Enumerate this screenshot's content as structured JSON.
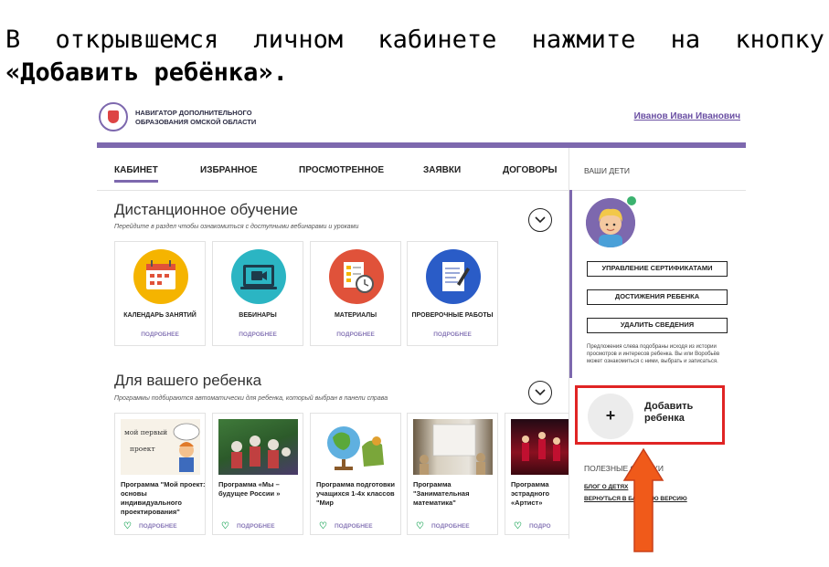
{
  "instruction": {
    "line1_words": [
      "В",
      "открывшемся",
      "личном",
      "кабинете",
      "нажмите",
      "на",
      "кнопку"
    ],
    "line2": "«Добавить ребёнка»."
  },
  "header": {
    "brand_line1": "НАВИГАТОР ДОПОЛНИТЕЛЬНОГО",
    "brand_line2": "ОБРАЗОВАНИЯ ОМСКОЙ ОБЛАСТИ",
    "user_name": "Иванов Иван Иванович"
  },
  "tabs": [
    "КАБИНЕТ",
    "ИЗБРАННОЕ",
    "ПРОСМОТРЕННОЕ",
    "ЗАЯВКИ",
    "ДОГОВОРЫ"
  ],
  "distance": {
    "title": "Дистанционное обучение",
    "subtitle": "Перейдите в раздел чтобы ознакомиться с доступными вебинарами и уроками",
    "more": "ПОДРОБНЕЕ",
    "cards": [
      {
        "name": "КАЛЕНДАРЬ ЗАНЯТИЙ",
        "icon": "calendar-icon"
      },
      {
        "name": "ВЕБИНАРЫ",
        "icon": "webcam-icon"
      },
      {
        "name": "МАТЕРИАЛЫ",
        "icon": "materials-clock-icon"
      },
      {
        "name": "ПРОВЕРОЧНЫЕ РАБОТЫ",
        "icon": "document-pencil-icon"
      }
    ]
  },
  "child": {
    "title": "Для вашего ребенка",
    "subtitle": "Программы подбираются автоматически для ребенка, который выбран в панели справа",
    "more": "ПОДРОБНЕЕ",
    "more_cut": "ПОДРО",
    "programs": [
      {
        "title": "Программа \"Мой проект: основы индивидуального проектирования\"",
        "img_text1": "мой первый",
        "img_text2": "проект"
      },
      {
        "title": "Программа «Мы – будущее России »"
      },
      {
        "title": "Программа подготовки учащихся 1-4х классов \"Мир"
      },
      {
        "title": "Программа \"Занимательная математика\""
      },
      {
        "title": "Программа эстрадного «Артист»"
      }
    ]
  },
  "right": {
    "header": "ВАШИ ДЕТИ",
    "buttons": [
      "УПРАВЛЕНИЕ СЕРТИФИКАТАМИ",
      "ДОСТИЖЕНИЯ РЕБЕНКА",
      "УДАЛИТЬ СВЕДЕНИЯ"
    ],
    "note": "Предложения слева подобраны исходя из истории просмотров и интересов ребенка. Вы или Воробьёв может ознакомиться с ними, выбрать и записаться.",
    "add_line1": "Добавить",
    "add_line2": "ребенка",
    "useful": "ПОЛЕЗНЫЕ ССЫЛКИ",
    "links": [
      "БЛОГ О ДЕТЯХ",
      "ВЕРНУТЬСЯ В БАЗОВУЮ ВЕРСИЮ"
    ]
  },
  "colors": {
    "accent": "#7d68ae",
    "highlight": "#e02424",
    "arrow": "#f05a1a",
    "heart": "#3bb26f"
  }
}
